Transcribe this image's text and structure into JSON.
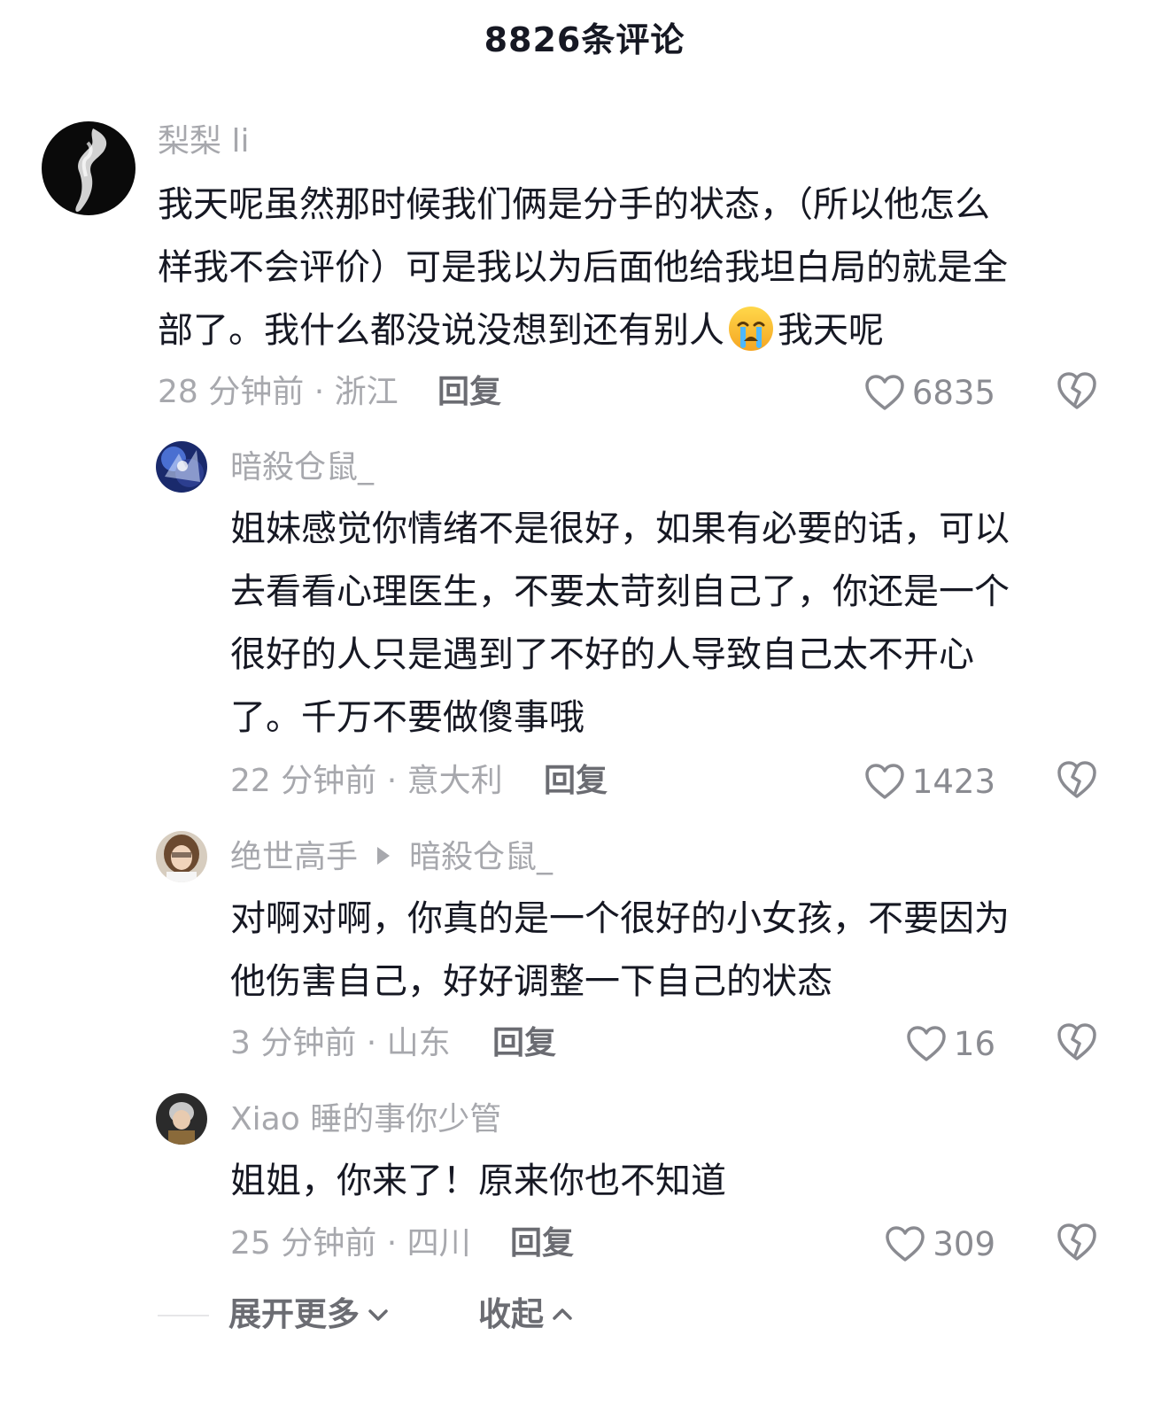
{
  "header": {
    "title": "8826条评论"
  },
  "comments": [
    {
      "username": "梨梨 li",
      "lines": [
        "我天呢虽然那时候我们俩是分手的状态，（所以他怎么",
        "样我不会评价）可是我以为后面他给我坦白局的就是全"
      ],
      "last_line_before_emoji": "部了。我什么都没说没想到还有别人",
      "last_line_after_emoji": "我天呢",
      "emoji": "crying-face-emoji",
      "meta": "28 分钟前 · 浙江",
      "reply_label": "回复",
      "likes": "6835"
    },
    {
      "username": "暗殺仓鼠_",
      "lines": [
        "姐妹感觉你情绪不是很好，如果有必要的话，可以",
        "去看看心理医生，不要太苛刻自己了，你还是一个",
        "很好的人只是遇到了不好的人导致自己太不开心",
        "了。千万不要做傻事哦"
      ],
      "meta": "22 分钟前 · 意大利",
      "reply_label": "回复",
      "likes": "1423"
    },
    {
      "username": "绝世高手",
      "reply_to": "暗殺仓鼠_",
      "lines": [
        "对啊对啊，你真的是一个很好的小女孩，不要因为",
        "他伤害自己，好好调整一下自己的状态"
      ],
      "meta": "3 分钟前 · 山东",
      "reply_label": "回复",
      "likes": "16"
    },
    {
      "username": "Xiao 睡的事你少管",
      "lines": [
        "姐姐，你来了！原来你也不知道"
      ],
      "meta": "25 分钟前 · 四川",
      "reply_label": "回复",
      "likes": "309"
    }
  ],
  "footer": {
    "expand_label": "展开更多",
    "collapse_label": "收起"
  },
  "icons": {
    "like": "heart-outline-icon",
    "dislike": "broken-heart-icon",
    "expand": "chevron-down-icon",
    "collapse": "chevron-up-icon"
  }
}
